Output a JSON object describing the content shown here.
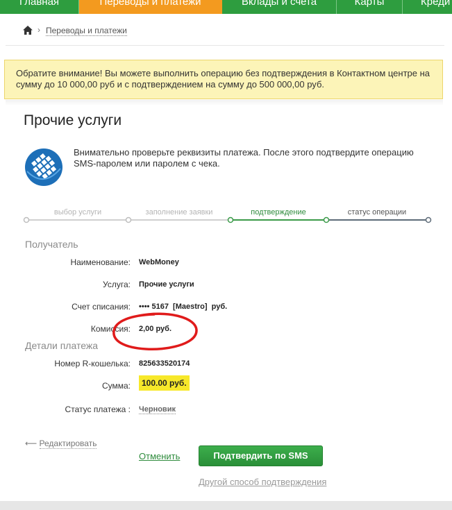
{
  "nav": {
    "tabs": [
      {
        "label": "Главная",
        "active": false
      },
      {
        "label": "Переводы и платежи",
        "active": true
      },
      {
        "label": "Вклады и счета",
        "active": false
      },
      {
        "label": "Карты",
        "active": false
      },
      {
        "label": "Кредиты",
        "active": false
      }
    ]
  },
  "breadcrumb": {
    "home_icon": "home-icon",
    "separator": "›",
    "link": "Переводы и платежи"
  },
  "notice": {
    "text": "Обратите внимание! Вы можете выполнить операцию без подтверждения в Контактном центре на сумму до 10 000,00 руб и с подтверждением на сумму до 500 000,00 руб."
  },
  "page": {
    "title": "Прочие услуги",
    "logo_icon": "webmoney-logo-icon",
    "intro": "Внимательно проверьте реквизиты платежа. После этого подтвердите операцию SMS-паролем или паролем с чека."
  },
  "steps": [
    {
      "label": "выбор услуги",
      "state": "done"
    },
    {
      "label": "заполнение заявки",
      "state": "done"
    },
    {
      "label": "подтверждение",
      "state": "current"
    },
    {
      "label": "статус операции",
      "state": "future"
    }
  ],
  "recipient": {
    "title": "Получатель",
    "name_label": "Наименование:",
    "name_value": "WebMoney",
    "service_label": "Услуга:",
    "service_value": "Прочие услуги",
    "account_label": "Счет списания:",
    "account_value": "•••• 5167  [Maestro]  руб.",
    "commission_label": "Комиссия:",
    "commission_value": "2,00 руб."
  },
  "details": {
    "title": "Детали платежа",
    "wallet_label": "Номер R-кошелька:",
    "wallet_value": "825633520174",
    "sum_label": "Сумма:",
    "sum_value": "100.00 руб.",
    "status_label": "Статус платежа :",
    "status_value": "Черновик"
  },
  "actions": {
    "edit_arrow": "⟵",
    "edit_label": "Редактировать",
    "cancel_label": "Отменить",
    "confirm_label": "Подтвердить по SMS",
    "alt_label": "Другой способ подтверждения"
  },
  "colors": {
    "nav_green": "#2e9d3f",
    "nav_active_orange": "#f39a1f",
    "notice_bg": "#fcf4b8",
    "button_green": "#2e9d3f",
    "amount_highlight": "#f7e82a",
    "annotation_red": "#e01b1b"
  }
}
